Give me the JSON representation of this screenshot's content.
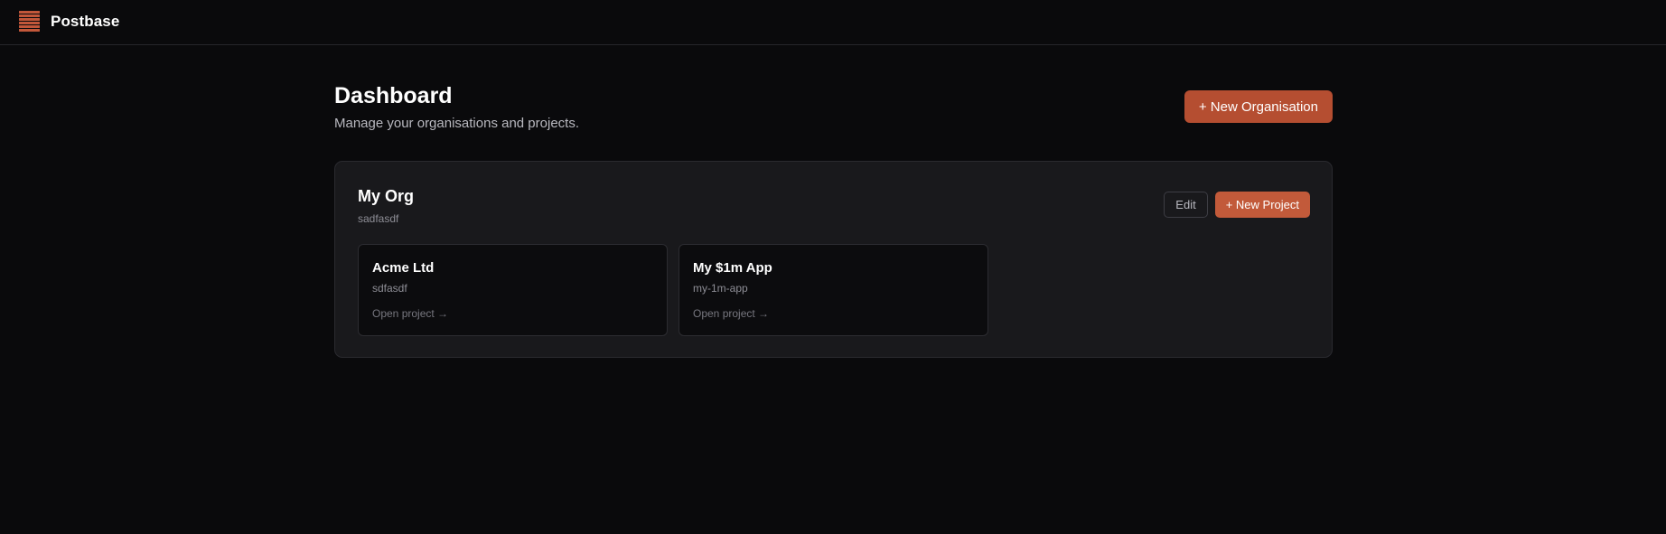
{
  "app": {
    "name": "Postbase",
    "logo_icon": "stacked-bars-logo-icon",
    "accent_color": "#b54e31"
  },
  "header": {
    "title": "Dashboard",
    "subtitle": "Manage your organisations and projects.",
    "new_org_label": "+ New Organisation"
  },
  "organisations": [
    {
      "name": "My Org",
      "slug": "sadfasdf",
      "edit_label": "Edit",
      "new_project_label": "+ New Project",
      "projects": [
        {
          "name": "Acme Ltd",
          "slug": "sdfasdf",
          "link_label": "Open project →"
        },
        {
          "name": "My $1m App",
          "slug": "my-1m-app",
          "link_label": "Open project →"
        }
      ]
    }
  ]
}
